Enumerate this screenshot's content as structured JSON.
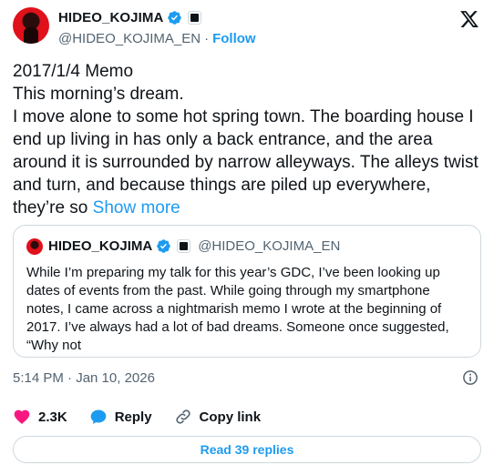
{
  "author": {
    "display_name": "HIDEO_KOJIMA",
    "handle": "@HIDEO_KOJIMA_EN",
    "separator": "·",
    "follow_label": "Follow"
  },
  "tweet": {
    "lines": [
      "2017/1/4 Memo",
      "This morning’s dream.",
      "I move alone to some hot spring town. The boarding house I end up living in has only a back entrance, and the area around it is surrounded by narrow alleyways. The alleys twist and turn, and because things are piled up everywhere, they’re so"
    ],
    "show_more_label": "Show more"
  },
  "quote": {
    "display_name": "HIDEO_KOJIMA",
    "handle": "@HIDEO_KOJIMA_EN",
    "text": "While I’m preparing my talk for this year’s GDC, I’ve been looking up dates of events from the past. While going through my smartphone notes, I came across a nightmarish memo I wrote at the beginning of 2017. I’ve always had a lot of bad dreams. Someone once suggested, “Why not"
  },
  "timestamp": "5:14 PM · Jan 10, 2026",
  "actions": {
    "like_count": "2.3K",
    "reply_label": "Reply",
    "copy_link_label": "Copy link"
  },
  "read_replies_label": "Read 39 replies",
  "icons": {
    "verified": "verified-badge-icon",
    "affiliate": "affiliate-badge-icon",
    "x_logo": "x-logo-icon",
    "info": "info-icon",
    "like": "heart-icon",
    "reply": "reply-bubble-icon",
    "copy_link": "link-icon"
  },
  "colors": {
    "accent": "#1d9bf0",
    "like": "#f91880",
    "text": "#0f1419",
    "muted": "#536471",
    "border": "#cfd9de"
  }
}
